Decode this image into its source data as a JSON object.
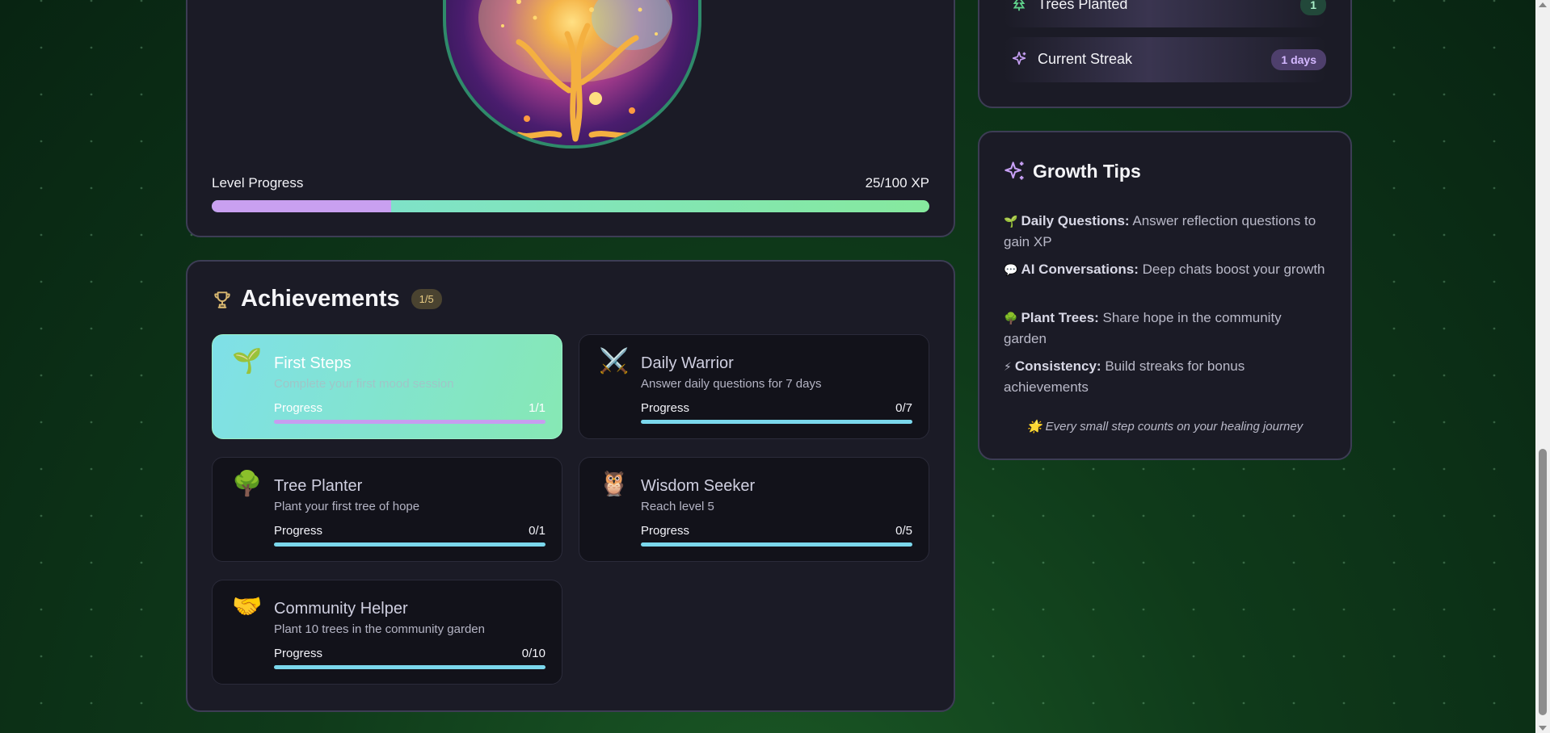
{
  "level": {
    "label": "Level Progress",
    "value_text": "25/100 XP",
    "progress": 0.25
  },
  "stats": {
    "trees_planted": {
      "label": "Trees Planted",
      "value": "1"
    },
    "current_streak": {
      "label": "Current Streak",
      "value": "1 days"
    }
  },
  "achievements": {
    "title": "Achievements",
    "count": "1/5",
    "progress_label": "Progress",
    "items": [
      {
        "icon": "🌱",
        "title": "First Steps",
        "desc": "Complete your first mood session",
        "progress": "1/1",
        "fraction": 1.0,
        "completed": true
      },
      {
        "icon": "⚔️",
        "title": "Daily Warrior",
        "desc": "Answer daily questions for 7 days",
        "progress": "0/7",
        "fraction": 0,
        "completed": false
      },
      {
        "icon": "🌳",
        "title": "Tree Planter",
        "desc": "Plant your first tree of hope",
        "progress": "0/1",
        "fraction": 0,
        "completed": false
      },
      {
        "icon": "🦉",
        "title": "Wisdom Seeker",
        "desc": "Reach level 5",
        "progress": "0/5",
        "fraction": 0,
        "completed": false
      },
      {
        "icon": "🤝",
        "title": "Community Helper",
        "desc": "Plant 10 trees in the community garden",
        "progress": "0/10",
        "fraction": 0,
        "completed": false
      }
    ]
  },
  "tips": {
    "title": "Growth Tips",
    "items": [
      {
        "emoji": "🌱",
        "bold": "Daily Questions:",
        "text": "Answer reflection questions to gain XP"
      },
      {
        "emoji": "💬",
        "bold": "AI Conversations:",
        "text": "Deep chats boost your growth"
      },
      {
        "emoji": "🌳",
        "bold": "Plant Trees:",
        "text": "Share hope in the community garden"
      },
      {
        "emoji": "⚡",
        "bold": "Consistency:",
        "text": "Build streaks for bonus achievements"
      }
    ],
    "footer": "🌟 Every small step counts on your healing journey"
  },
  "colors": {
    "accent_purple": "#c9a0f0",
    "accent_teal": "#7ce0d6",
    "accent_green": "#86e99e",
    "panel_bg": "#1b1b26"
  }
}
